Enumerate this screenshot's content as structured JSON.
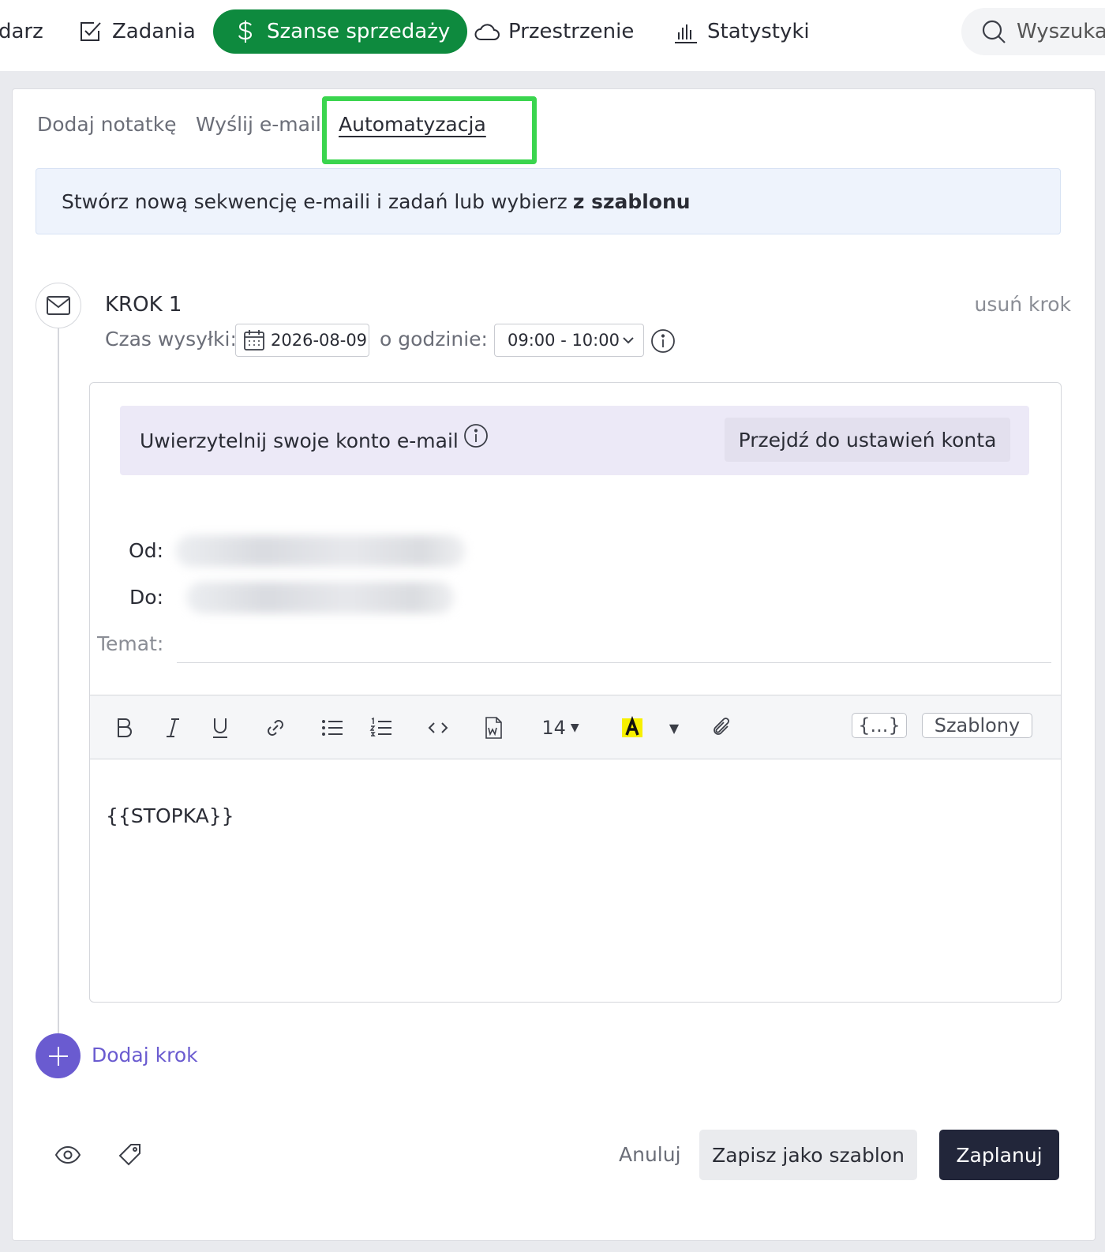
{
  "nav": {
    "items": [
      {
        "label": "darz",
        "icon": "calendar-icon"
      },
      {
        "label": "Zadania",
        "icon": "checkbox-icon"
      },
      {
        "label": "Szanse sprzedaży",
        "icon": "dollar-icon",
        "active": true
      },
      {
        "label": "Przestrzenie",
        "icon": "cloud-icon"
      },
      {
        "label": "Statystyki",
        "icon": "bar-chart-icon"
      }
    ],
    "search_placeholder": "Wyszukaj",
    "active_color": "#0e8a3e"
  },
  "tabs": [
    {
      "label": "Dodaj notatkę"
    },
    {
      "label": "Wyślij e-mail"
    },
    {
      "label": "Automatyzacja",
      "active": true
    }
  ],
  "banner": {
    "text": "Stwórz nową sekwencję e-maili i zadań lub wybierz",
    "link": "z szablonu"
  },
  "step": {
    "title": "KROK 1",
    "remove_label": "usuń krok",
    "send_time_label": "Czas wysyłki:",
    "date": "2026-08-09",
    "hour_label": "o godzinie:",
    "time_range": "09:00 - 10:00"
  },
  "email": {
    "auth_text": "Uwierzytelnij swoje konto e-mail",
    "auth_button": "Przejdź do ustawień konta",
    "from_label": "Od:",
    "to_label": "Do:",
    "subject_label": "Temat:",
    "font_size": "14",
    "variables_label": "{...}",
    "templates_label": "Szablony",
    "body": "{{STOPKA}}",
    "highlight_color": "#f7f000"
  },
  "add_step_label": "Dodaj krok",
  "footer": {
    "cancel": "Anuluj",
    "save_template": "Zapisz jako szablon",
    "schedule": "Zaplanuj"
  },
  "colors": {
    "accent_purple": "#6a5bd0",
    "primary_dark": "#22263a",
    "highlight_outline": "#3ad54e"
  }
}
